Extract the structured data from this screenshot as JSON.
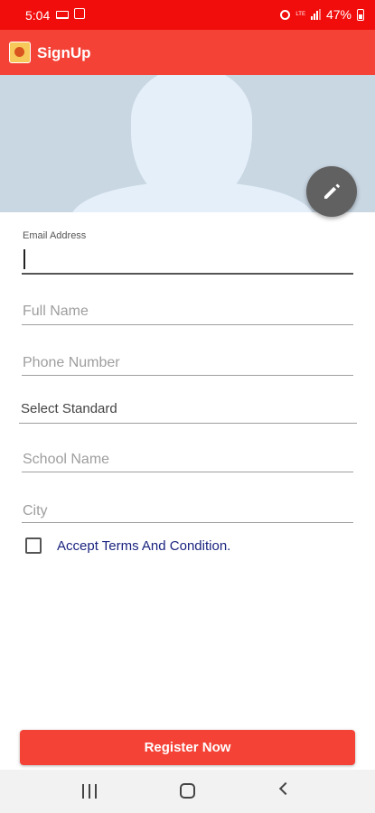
{
  "status_bar": {
    "time": "5:04",
    "network": "LTE",
    "battery": "47%"
  },
  "app_bar": {
    "title": "SignUp"
  },
  "form": {
    "email": {
      "label": "Email Address",
      "value": ""
    },
    "full_name": {
      "placeholder": "Full Name"
    },
    "phone": {
      "placeholder": "Phone Number"
    },
    "standard": {
      "selected": "Select Standard"
    },
    "school": {
      "placeholder": "School Name"
    },
    "city": {
      "placeholder": "City"
    },
    "terms": {
      "label": "Accept Terms And Condition.",
      "checked": false
    }
  },
  "register_button": {
    "label": "Register Now"
  },
  "icons": {
    "edit": "pencil-icon",
    "logo": "app-logo-icon",
    "nav_recents": "recents-icon",
    "nav_home": "home-icon",
    "nav_back": "back-icon"
  },
  "colors": {
    "status_bar": "#f20d0d",
    "app_bar": "#f44236",
    "header_bg": "#c9d7e3",
    "fab": "#616161",
    "terms_text": "#1a237e"
  }
}
